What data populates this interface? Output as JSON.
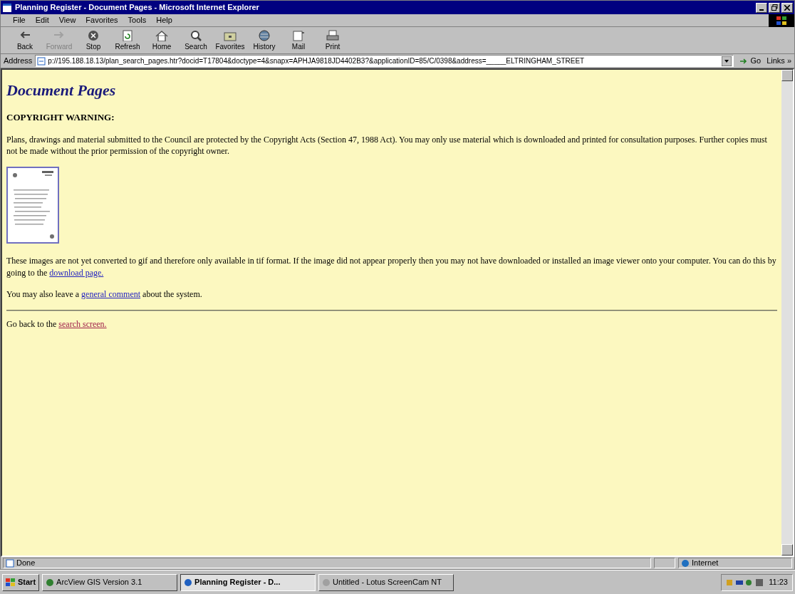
{
  "window": {
    "title": "Planning Register - Document Pages - Microsoft Internet Explorer"
  },
  "menu": [
    "File",
    "Edit",
    "View",
    "Favorites",
    "Tools",
    "Help"
  ],
  "toolbar": [
    {
      "kind": "back",
      "label": "Back",
      "disabled": false
    },
    {
      "kind": "forward",
      "label": "Forward",
      "disabled": true
    },
    {
      "kind": "stop",
      "label": "Stop",
      "disabled": false
    },
    {
      "kind": "refresh",
      "label": "Refresh",
      "disabled": false
    },
    {
      "kind": "home",
      "label": "Home",
      "disabled": false
    },
    {
      "kind": "search",
      "label": "Search",
      "disabled": false
    },
    {
      "kind": "favorites",
      "label": "Favorites",
      "disabled": false
    },
    {
      "kind": "history",
      "label": "History",
      "disabled": false
    },
    {
      "kind": "mail",
      "label": "Mail",
      "disabled": false
    },
    {
      "kind": "print",
      "label": "Print",
      "disabled": false
    }
  ],
  "address_bar": {
    "label": "Address",
    "value": "p://195.188.18.13/plan_search_pages.htr?docid=T17804&doctype=4&snapx=APHJA9818JD4402B3?&applicationID=85/C/0398&address=_____ELTRINGHAM_STREET",
    "go": "Go",
    "links": "Links »"
  },
  "page": {
    "heading": "Document Pages",
    "warning": "COPYRIGHT WARNING:",
    "paragraphs": [
      [
        {
          "text": "Plans, drawings and material submitted to the Council are protected by the Copyright Acts (Section 47, 1988 Act). You may only use material which is downloaded and printed for consultation purposes. Further copies must not be made without the prior permission of the copyright owner."
        }
      ],
      [
        {
          "kind": "thumbnail"
        }
      ],
      [
        {
          "text": "These images are not yet converted to gif and therefore only available in tif format. If the image did not appear properly then you may not have downloaded or installed an image viewer onto your computer. You can do this by going to the "
        },
        {
          "link": "download page.",
          "visited": false
        }
      ],
      [
        {
          "text": "You may also leave a "
        },
        {
          "link": "general comment",
          "visited": false
        },
        {
          "text": " about the system."
        }
      ],
      [
        {
          "kind": "rule"
        }
      ],
      [
        {
          "text": "Go back to the "
        },
        {
          "link": "search screen.",
          "visited": true
        }
      ]
    ]
  },
  "status_bar": {
    "text": "Done",
    "zone": "Internet"
  },
  "taskbar": {
    "start": "Start",
    "tasks": [
      {
        "label": "ArcView GIS Version 3.1",
        "selected": false
      },
      {
        "label": "Planning Register - D...",
        "selected": true
      },
      {
        "label": "Untitled - Lotus ScreenCam NT",
        "selected": false
      }
    ],
    "clock": "11:23"
  }
}
